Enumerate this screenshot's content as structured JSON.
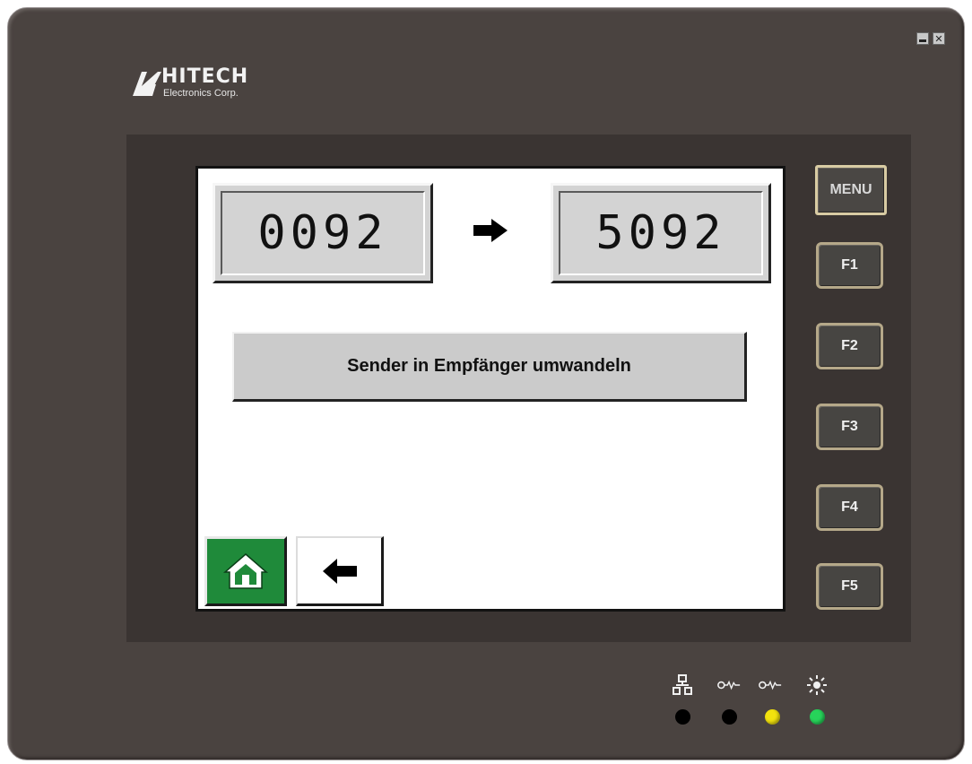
{
  "window": {
    "minimize_icon": "minimize-icon",
    "close_icon": "close-icon"
  },
  "logo": {
    "name": "HITECH",
    "subtitle": "Electronics Corp."
  },
  "screen": {
    "source_value": "0092",
    "target_value": "5092",
    "arrow_icon": "arrow-right-icon",
    "convert_button_label": "Sender in Empfänger umwandeln",
    "home_icon": "home-icon",
    "back_icon": "arrow-left-icon",
    "home_color": "#1f8a3a"
  },
  "function_keys": {
    "menu": "MENU",
    "f1": "F1",
    "f2": "F2",
    "f3": "F3",
    "f4": "F4",
    "f5": "F5"
  },
  "status_leds": [
    {
      "icon": "network-icon",
      "color": "#000000"
    },
    {
      "icon": "key-icon",
      "color": "#000000"
    },
    {
      "icon": "key-icon",
      "color": "#f2e20e"
    },
    {
      "icon": "power-light-icon",
      "color": "#27d35a"
    }
  ]
}
